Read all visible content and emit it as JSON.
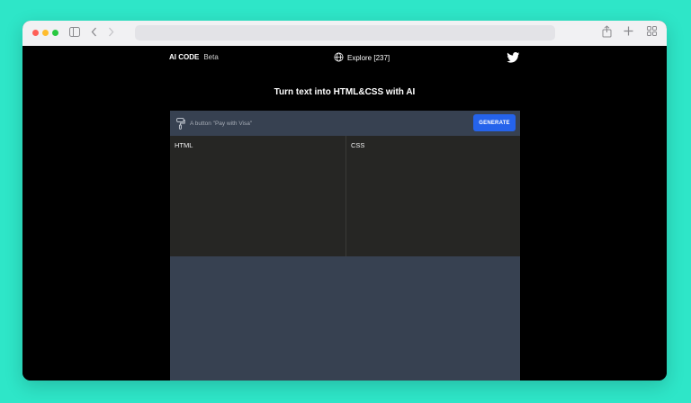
{
  "app": {
    "brand": "AI CODE",
    "badge": "Beta",
    "explore_label": "Explore [237]",
    "headline": "Turn text into HTML&CSS with AI"
  },
  "prompt": {
    "placeholder": "A button \"Pay with Visa\"",
    "value": ""
  },
  "buttons": {
    "generate_label": "GENERATE"
  },
  "editors": {
    "html_label": "HTML",
    "css_label": "CSS"
  },
  "colors": {
    "page_background": "#2ee6c8",
    "accent": "#2563eb",
    "panel": "#374151",
    "editor": "#262624",
    "app_background": "#000000"
  },
  "icons": [
    "sidebar-icon",
    "back-arrow-icon",
    "forward-arrow-icon",
    "share-icon",
    "new-tab-icon",
    "tab-overview-icon",
    "globe-icon",
    "twitter-icon",
    "paint-roller-icon"
  ]
}
